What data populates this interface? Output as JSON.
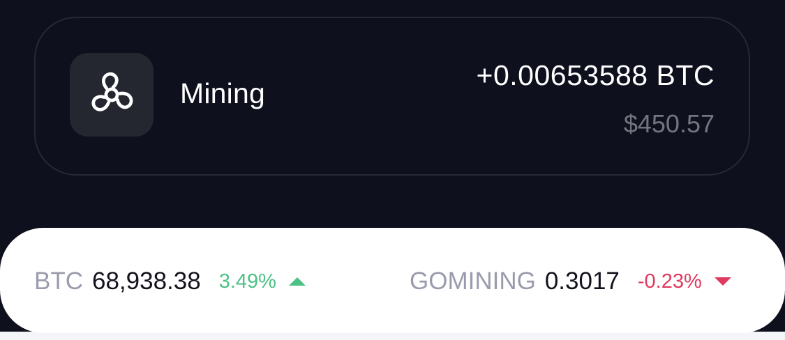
{
  "mining": {
    "label": "Mining",
    "icon": "fan-icon",
    "amount": "+0.00653588 BTC",
    "usd_value": "$450.57"
  },
  "tickers": [
    {
      "symbol": "BTC",
      "price": "68,938.38",
      "change": "3.49%",
      "direction": "up",
      "icon": "triangle-up-icon",
      "color": "#4cc285"
    },
    {
      "symbol": "GOMINING",
      "price": "0.3017",
      "change": "-0.23%",
      "direction": "down",
      "icon": "triangle-down-icon",
      "color": "#e0395e"
    }
  ],
  "colors": {
    "background": "#0e101d",
    "card_border": "#262834",
    "icon_tile": "#252730",
    "muted_text": "#74757f",
    "ticker_symbol": "#9a9cad",
    "up": "#4cc285",
    "down": "#e0395e"
  }
}
